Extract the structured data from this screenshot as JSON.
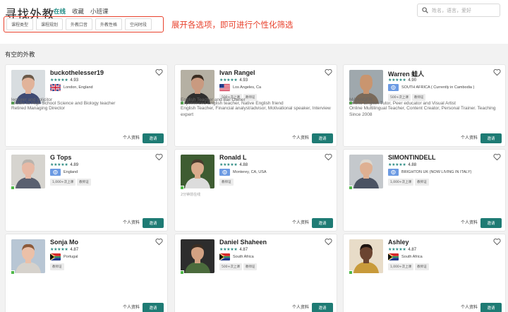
{
  "header": {
    "title": "寻找外教",
    "nav": [
      "在线",
      "收藏",
      "小班课"
    ],
    "search_placeholder": "姓名，语言，爱好"
  },
  "filters": [
    "课程类型",
    "课程规划",
    "外教口音",
    "外教性格",
    "空闲时段"
  ],
  "annotation": "展开各选项，即可进行个性化筛选",
  "section_title": "有空的外教",
  "card_actions": {
    "profile": "个人资料",
    "invite": "邀请"
  },
  "teachers": [
    {
      "name": "buckothelesser19",
      "stars": "★★★★★",
      "rating": "4.93",
      "location": "London, England",
      "flag": "uk",
      "badges": [],
      "headline": "Retired Managing Director",
      "sub": ""
    },
    {
      "name": "Ivan Rangel",
      "stars": "★★★★★",
      "rating": "4.93",
      "location": "Los Angeles, Ca",
      "flag": "us",
      "badges": [
        "500+次上课",
        "教师证"
      ],
      "headline": "English Teacher, Financial analyst/advisor, Motivational speaker, Interview expert",
      "sub": ""
    },
    {
      "name": "Warren 蛙人",
      "stars": "★★★★★",
      "rating": "4.90",
      "location": "SOUTH AFRICA ( Currently in Cambodia )",
      "flag": "un",
      "badges": [
        "500+次上课",
        "教师证"
      ],
      "headline": "Online Multilingual Teacher, Content Creator, Personal Trainer. Teaching Since 2008",
      "sub": ""
    },
    {
      "name": "G Tops",
      "stars": "★★★★★",
      "rating": "4.89",
      "location": "England",
      "flag": "un",
      "badges": [
        "1,000+次上课",
        "教师证"
      ],
      "headline": "lecturer and solicitor",
      "sub": ""
    },
    {
      "name": "Ronald L",
      "stars": "★★★★★",
      "rating": "4.88",
      "location": "Monterey, CA, USA",
      "flag": "un",
      "badges": [
        "教师证"
      ],
      "headline": "English Teacher and Bar Owner",
      "sub": "2分钟前在线"
    },
    {
      "name": "SIMONTINDELL",
      "stars": "★★★★★",
      "rating": "4.88",
      "location": "BRIGHTON UK (NOW LIVING IN ITALY)",
      "flag": "un",
      "badges": [
        "1,000+次上课",
        "教师证"
      ],
      "headline": "MANAGER",
      "sub": ""
    },
    {
      "name": "Sonja Mo",
      "stars": "★★★★★",
      "rating": "4.87",
      "location": "Portugal",
      "flag": "za",
      "badges": [
        "教师证"
      ],
      "headline": "Middle to High School Science and Biology teacher",
      "sub": ""
    },
    {
      "name": "Daniel Shaheen",
      "stars": "★★★★★",
      "rating": "4.87",
      "location": "South Africa",
      "flag": "za",
      "badges": [
        "500+次上课",
        "教师证"
      ],
      "headline": "Experienced English teacher, Native English friend",
      "sub": ""
    },
    {
      "name": "Ashley",
      "stars": "★★★★★",
      "rating": "4.87",
      "location": "South Africa",
      "flag": "za",
      "badges": [
        "1,000+次上课",
        "教师证"
      ],
      "headline": "Online English Tutor, Peer educator and Visual Artist",
      "sub": ""
    }
  ],
  "colors": {
    "accent": "#1e7b74",
    "annotation": "#e8412c",
    "star": "#2b8a82",
    "online": "#4fb848"
  }
}
